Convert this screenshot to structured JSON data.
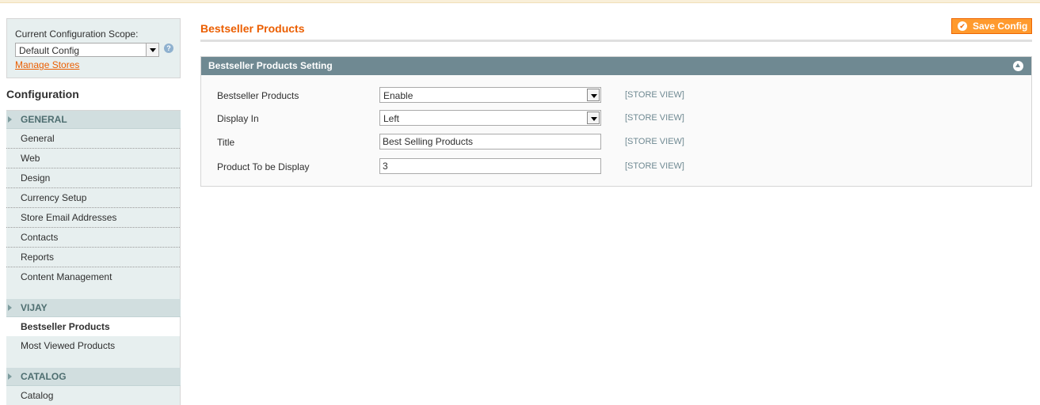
{
  "scope": {
    "label": "Current Configuration Scope:",
    "selected": "Default Config",
    "manage_link": "Manage Stores"
  },
  "sidebar": {
    "title": "Configuration",
    "groups": [
      {
        "label": "GENERAL",
        "items": [
          "General",
          "Web",
          "Design",
          "Currency Setup",
          "Store Email Addresses",
          "Contacts",
          "Reports",
          "Content Management"
        ]
      },
      {
        "label": "VIJAY",
        "items": [
          "Bestseller Products",
          "Most Viewed Products"
        ]
      },
      {
        "label": "CATALOG",
        "items": [
          "Catalog"
        ]
      }
    ]
  },
  "main": {
    "page_title": "Bestseller Products",
    "save_label": "Save Config",
    "section_title": "Bestseller Products Setting",
    "scope_tag": "[STORE VIEW]",
    "fields": [
      {
        "label": "Bestseller Products",
        "value": "Enable"
      },
      {
        "label": "Display In",
        "value": "Left"
      },
      {
        "label": "Title",
        "value": "Best Selling Products"
      },
      {
        "label": "Product To be Display",
        "value": "3"
      }
    ]
  },
  "colors": {
    "accent": "#eb5e00",
    "button": "#ff9a2e",
    "section_header": "#6f8992",
    "sidebar_bg": "#e7efef"
  }
}
